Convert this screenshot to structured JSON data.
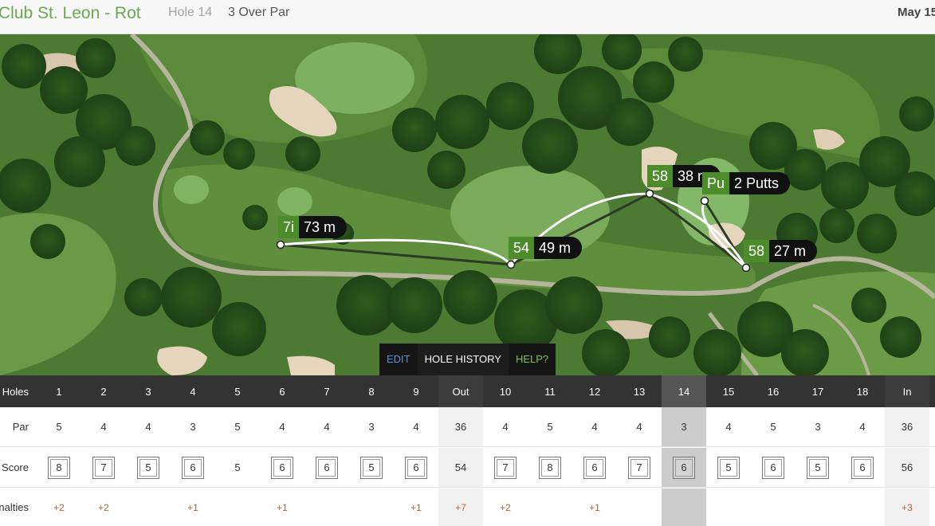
{
  "header": {
    "course": "Club St. Leon - Rot",
    "hole": "Hole 14",
    "result": "3 Over Par",
    "date": "May 15"
  },
  "map": {
    "shots": [
      {
        "club": "7i",
        "distance": "73 m"
      },
      {
        "club": "54",
        "distance": "49 m"
      },
      {
        "club": "58",
        "distance": "38 m"
      },
      {
        "club": "Pu",
        "distance": "2 Putts"
      },
      {
        "club": "58",
        "distance": "27 m"
      }
    ],
    "toolbar": {
      "edit": "EDIT",
      "history": "HOLE HISTORY",
      "help": "HELP?"
    }
  },
  "scorecard": {
    "labels": {
      "holes": "Holes",
      "par": "Par",
      "score": "Score",
      "penalties": "Penalties"
    },
    "columns": [
      "1",
      "2",
      "3",
      "4",
      "5",
      "6",
      "7",
      "8",
      "9",
      "Out",
      "10",
      "11",
      "12",
      "13",
      "14",
      "15",
      "16",
      "17",
      "18",
      "In"
    ],
    "par": [
      "5",
      "4",
      "4",
      "3",
      "5",
      "4",
      "4",
      "3",
      "4",
      "36",
      "4",
      "5",
      "4",
      "4",
      "3",
      "4",
      "5",
      "3",
      "4",
      "36"
    ],
    "score": [
      "8",
      "7",
      "5",
      "6",
      "5",
      "6",
      "6",
      "5",
      "6",
      "54",
      "7",
      "8",
      "6",
      "7",
      "6",
      "5",
      "6",
      "5",
      "6",
      "56"
    ],
    "penalties": [
      "+2",
      "+2",
      "",
      "+1",
      "",
      "+1",
      "",
      "",
      "+1",
      "+7",
      "+2",
      "",
      "+1",
      "",
      "",
      "",
      "",
      "",
      "",
      "+3"
    ],
    "current_hole": "14"
  }
}
